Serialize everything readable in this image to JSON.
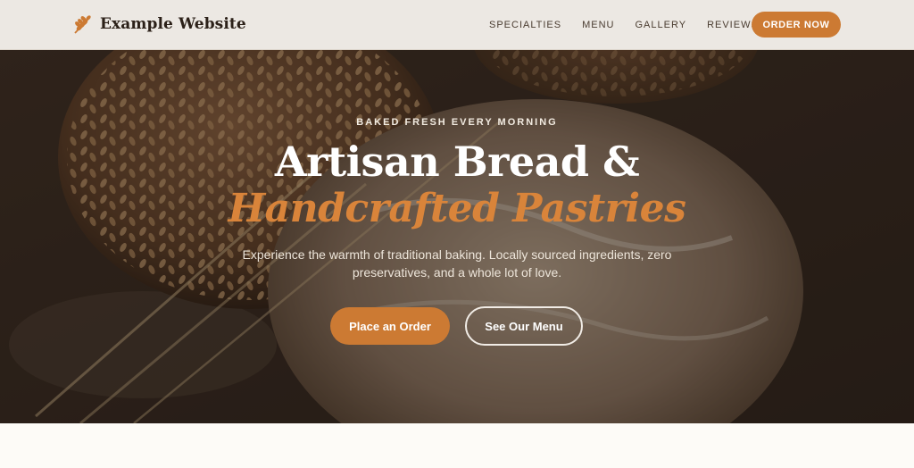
{
  "header": {
    "brand": "Example Website",
    "nav": [
      "SPECIALTIES",
      "MENU",
      "GALLERY",
      "REVIEWS"
    ],
    "cta": "ORDER NOW"
  },
  "hero": {
    "eyebrow": "BAKED FRESH EVERY MORNING",
    "title_line1": "Artisan Bread &",
    "title_line2": "Handcrafted Pastries",
    "description": "Experience the warmth of traditional baking. Locally sourced ingredients, zero preservatives, and a whole lot of love.",
    "primary_button": "Place an Order",
    "secondary_button": "See Our Menu"
  },
  "colors": {
    "accent": "#cc7a33",
    "header_bg": "#ece8e3",
    "heading_dark": "#2b2018"
  },
  "icons": {
    "logo": "wheat-icon"
  }
}
